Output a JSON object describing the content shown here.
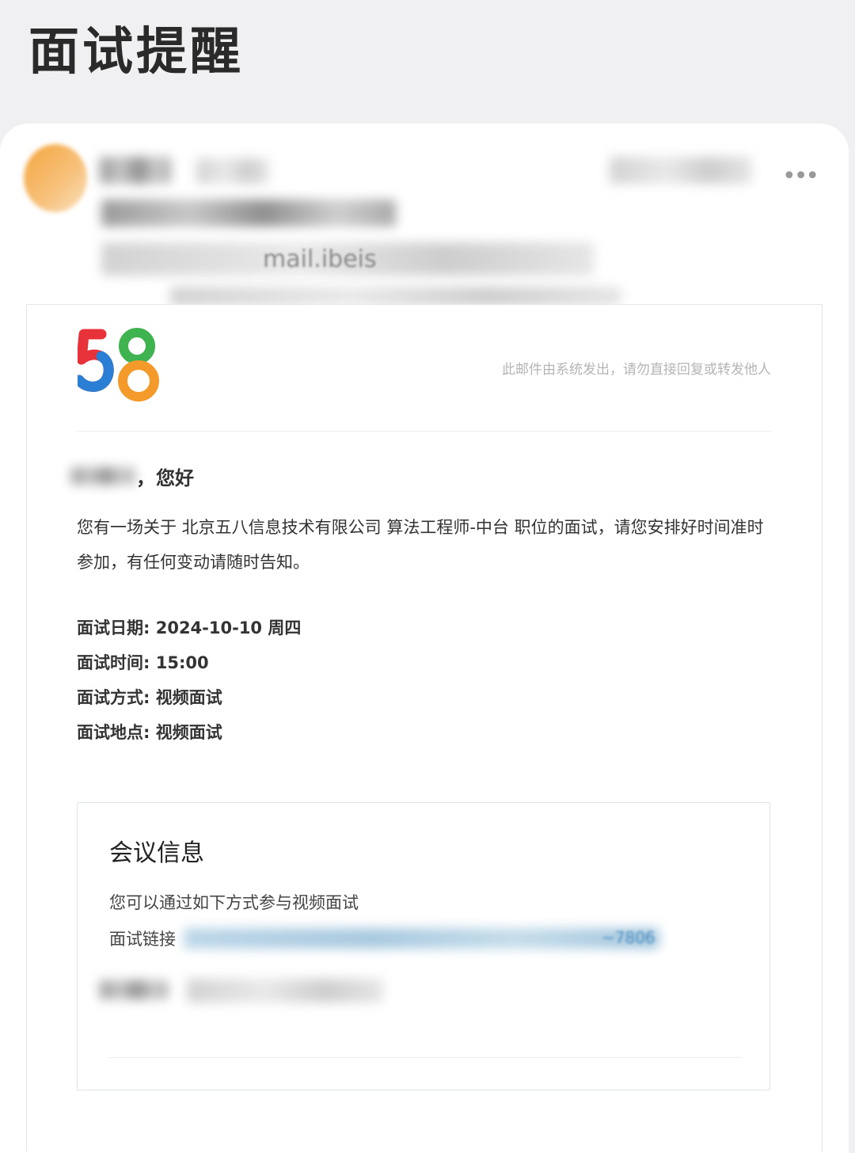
{
  "page": {
    "title": "面试提醒"
  },
  "mail_header": {
    "partial_email": "mail.ibeis"
  },
  "mail": {
    "system_note": "此邮件由系统发出，请勿直接回复或转发他人",
    "greeting_comma": "，",
    "greeting": "您好",
    "intro": "您有一场关于 北京五八信息技术有限公司 算法工程师-中台 职位的面试，请您安排好时间准时参加，有任何变动请随时告知。",
    "details": [
      {
        "label": "面试日期: ",
        "value": "2024-10-10 周四"
      },
      {
        "label": "面试时间: ",
        "value": "15:00"
      },
      {
        "label": "面试方式: ",
        "value": "视频面试"
      },
      {
        "label": "面试地点: ",
        "value": "视频面试"
      }
    ],
    "meeting": {
      "title": "会议信息",
      "description": "您可以通过如下方式参与视频面试",
      "link_label": "面试链接",
      "link_tail": "~7806"
    }
  },
  "icons": {
    "more": "more-dots-icon",
    "logo": "58-logo"
  },
  "colors": {
    "logo_red": "#e8323a",
    "logo_blue": "#2a7fd4",
    "logo_green": "#3fb34f",
    "logo_orange": "#f39a2a",
    "link": "#4d8fc2"
  }
}
